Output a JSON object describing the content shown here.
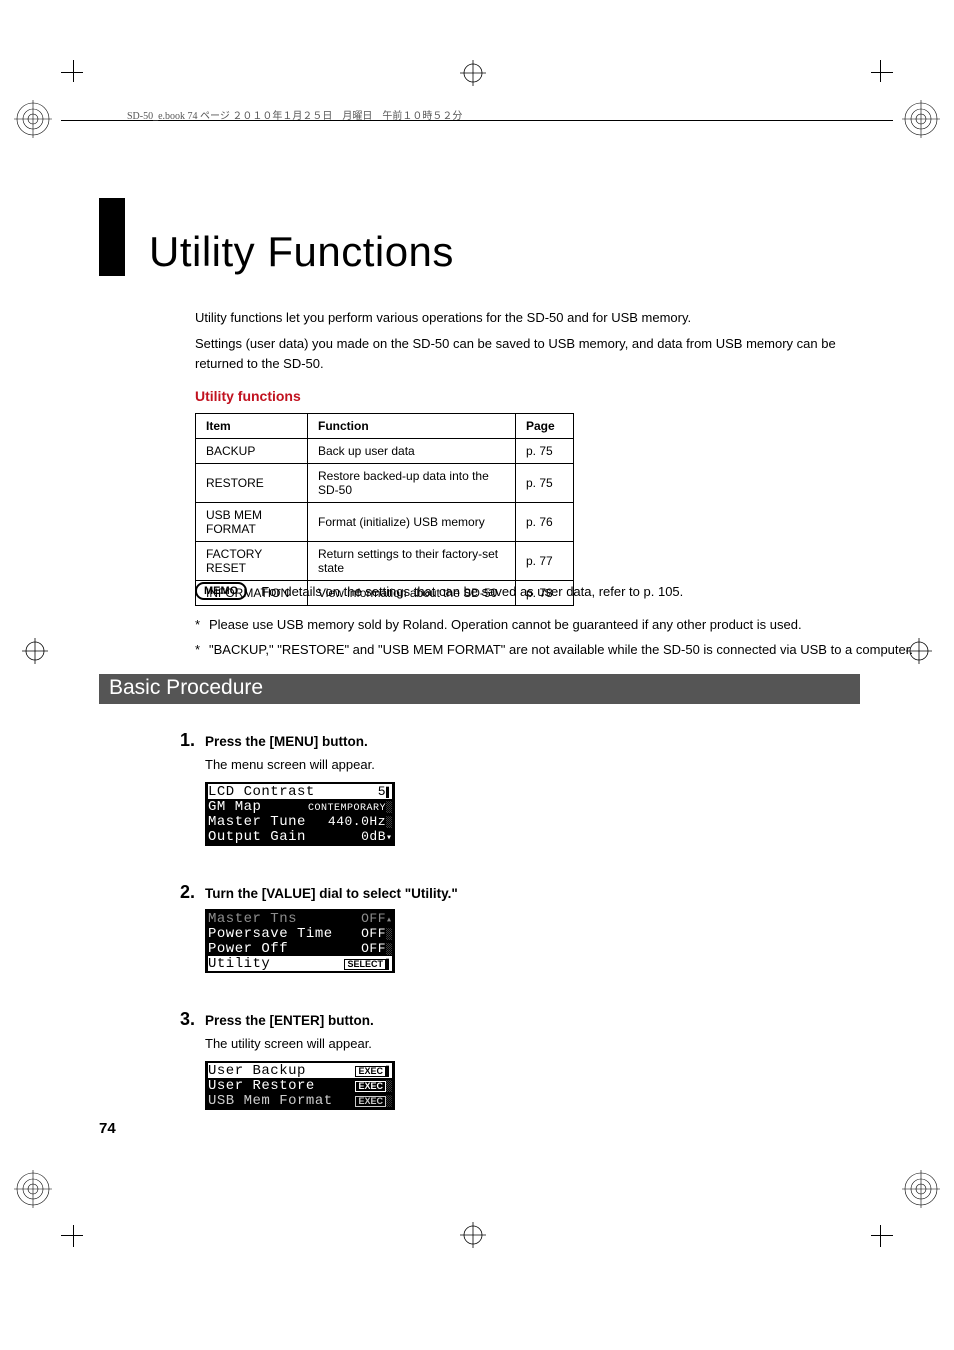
{
  "header": {
    "running": "SD-50_e.book  74 ページ  ２０１０年１月２５日　月曜日　午前１０時５２分"
  },
  "title": "Utility Functions",
  "intro": {
    "p1": "Utility functions let you perform various operations for the SD-50 and for USB memory.",
    "p2": "Settings (user data) you made on the SD-50 can be saved to USB memory, and data from USB memory can be returned to the SD-50."
  },
  "subhead": "Utility functions",
  "table": {
    "headers": {
      "item": "Item",
      "func": "Function",
      "page": "Page"
    },
    "rows": [
      {
        "item": "BACKUP",
        "func": "Back up user data",
        "page": "p. 75"
      },
      {
        "item": "RESTORE",
        "func": "Restore backed-up data into the SD-50",
        "page": "p. 75"
      },
      {
        "item": "USB MEM FORMAT",
        "func": "Format (initialize) USB memory",
        "page": "p. 76"
      },
      {
        "item": "FACTORY RESET",
        "func": "Return settings to their factory-set state",
        "page": "p. 77"
      },
      {
        "item": "INFORMATION",
        "func": "View information about the SD-50",
        "page": "p. 78"
      }
    ]
  },
  "memo": {
    "label": "MEMO",
    "text": "For details on the settings that can be saved as user data, refer to p. 105."
  },
  "notes": {
    "n1": "Please use USB memory sold by Roland. Operation cannot be guaranteed if any other product is used.",
    "n2": "\"BACKUP,\" \"RESTORE\" and \"USB MEM FORMAT\" are not available while the SD-50 is connected via USB to a computer."
  },
  "section": "Basic Procedure",
  "steps": {
    "s1": {
      "num": "1.",
      "title": "Press the [MENU] button.",
      "body": "The menu screen will appear."
    },
    "s2": {
      "num": "2.",
      "title": "Turn the [VALUE] dial to select \"Utility.\"",
      "body": ""
    },
    "s3": {
      "num": "3.",
      "title": "Press the [ENTER] button.",
      "body": "The utility screen will appear."
    }
  },
  "lcd1": {
    "r1a": "LCD Contrast",
    "r1b": "5",
    "r2a": "GM Map",
    "r2b": "CONTEMPORARY",
    "r3a": "Master Tune",
    "r3b": "440.0Hz",
    "r4a": "Output Gain",
    "r4b": "0dB"
  },
  "lcd2": {
    "r1a": "Master Tns",
    "r1b": "OFF",
    "r2a": "Powersave Time",
    "r2b": "OFF",
    "r3a": "Power Off",
    "r3b": "OFF",
    "r4a": "Utility",
    "r4b": "SELECT"
  },
  "lcd3": {
    "r1a": "User Backup",
    "r1b": "EXEC",
    "r2a": "User Restore",
    "r2b": "EXEC",
    "r3a": "USB Mem Format",
    "r3b": "EXEC"
  },
  "pagenum": "74"
}
